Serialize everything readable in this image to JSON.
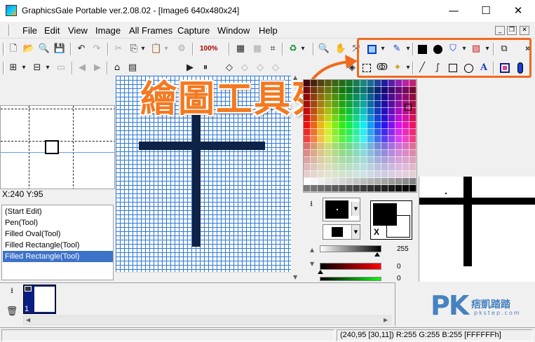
{
  "window": {
    "title": "GraphicsGale Portable ver.2.08.02 - [Image6 640x480x24]",
    "minimize_glyph": "—",
    "maximize_glyph": "☐",
    "close_glyph": "✕"
  },
  "menu": {
    "items": [
      "File",
      "Edit",
      "View",
      "Image",
      "All Frames",
      "Capture",
      "Window",
      "Help"
    ],
    "mdi_minimize": "_",
    "mdi_restore": "❐",
    "mdi_close": "✕"
  },
  "toolbar": {
    "zoom_label": "100%",
    "overflow_glyph": "»"
  },
  "overlay": {
    "title": "繪圖工具列",
    "highlight_color": "#f06a1e"
  },
  "preview": {
    "coordinates": "X:240 Y:95"
  },
  "history": {
    "items": [
      "(Start Edit)",
      "Pen(Tool)",
      "Filled Oval(Tool)",
      "Filled Rectangle(Tool)",
      "Filled Rectangle(Tool)"
    ],
    "selected_index": 4
  },
  "colors": {
    "grid_line": "#2f78d8",
    "drawing_stroke": "#0e2347",
    "selection": "#3c72c8",
    "foreground": "#000000",
    "background": "#ffffff"
  },
  "color_panel": {
    "swap_label": "X",
    "alpha_value": "255",
    "red_value": "0",
    "green_value": "0"
  },
  "frames": {
    "frame_number": "1"
  },
  "status": {
    "text": "(240,95 [30,11]) R:255 G:255 B:255 [FFFFFFh]"
  },
  "watermark": {
    "logo": "PK",
    "name": "痞凱踏踏",
    "url": "pkstep.com"
  }
}
